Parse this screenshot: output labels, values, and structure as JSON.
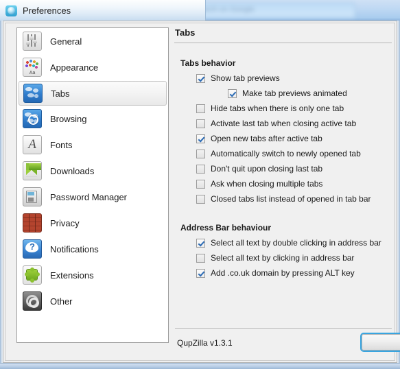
{
  "window": {
    "title": "Preferences",
    "icon": "qupzilla-logo-icon"
  },
  "background_browser": {
    "url_placeholder": "Enter URL address or search on Google",
    "back_icon": "back-arrow-icon",
    "site_icon": "site-favicon-icon"
  },
  "sidebar": {
    "items": [
      {
        "label": "General",
        "icon": "sliders-icon",
        "selected": false
      },
      {
        "label": "Appearance",
        "icon": "palette-icon",
        "selected": false
      },
      {
        "label": "Tabs",
        "icon": "globe-tabs-icon",
        "selected": true
      },
      {
        "label": "Browsing",
        "icon": "compass-icon",
        "selected": false
      },
      {
        "label": "Fonts",
        "icon": "letter-a-icon",
        "selected": false
      },
      {
        "label": "Downloads",
        "icon": "download-icon",
        "selected": false
      },
      {
        "label": "Password Manager",
        "icon": "safe-icon",
        "selected": false
      },
      {
        "label": "Privacy",
        "icon": "firewall-icon",
        "selected": false
      },
      {
        "label": "Notifications",
        "icon": "speech-bubble-question-icon",
        "selected": false
      },
      {
        "label": "Extensions",
        "icon": "puzzle-piece-icon",
        "selected": false
      },
      {
        "label": "Other",
        "icon": "gears-icon",
        "selected": false
      }
    ]
  },
  "main": {
    "title": "Tabs",
    "groups": [
      {
        "title": "Tabs behavior",
        "options": [
          {
            "label": "Show tab previews",
            "checked": true,
            "indent": false
          },
          {
            "label": "Make tab previews animated",
            "checked": true,
            "indent": true
          },
          {
            "label": "Hide tabs when there is only one tab",
            "checked": false,
            "indent": false
          },
          {
            "label": "Activate last tab when closing active tab",
            "checked": false,
            "indent": false
          },
          {
            "label": "Open new tabs after active tab",
            "checked": true,
            "indent": false
          },
          {
            "label": "Automatically switch to newly opened tab",
            "checked": false,
            "indent": false
          },
          {
            "label": "Don't quit upon closing last tab",
            "checked": false,
            "indent": false
          },
          {
            "label": "Ask when closing multiple tabs",
            "checked": false,
            "indent": false
          },
          {
            "label": "Closed tabs list instead of opened in tab bar",
            "checked": false,
            "indent": false
          }
        ]
      },
      {
        "title": "Address Bar behaviour",
        "options": [
          {
            "label": "Select all text by double clicking in address bar",
            "checked": true,
            "indent": false
          },
          {
            "label": "Select all text by clicking in address bar",
            "checked": false,
            "indent": false
          },
          {
            "label": "Add .co.uk domain by pressing ALT key",
            "checked": true,
            "indent": false
          }
        ]
      }
    ]
  },
  "footer": {
    "version": "QupZilla v1.3.1",
    "ok_button_label": ""
  },
  "colors": {
    "accent": "#39a5e0",
    "checkmark": "#2a6ab4",
    "titlebar_gradient_top": "#fdfefe",
    "titlebar_gradient_bottom": "#c7dcf0",
    "dialog_background": "#f0f0f0",
    "list_background": "#ffffff"
  }
}
